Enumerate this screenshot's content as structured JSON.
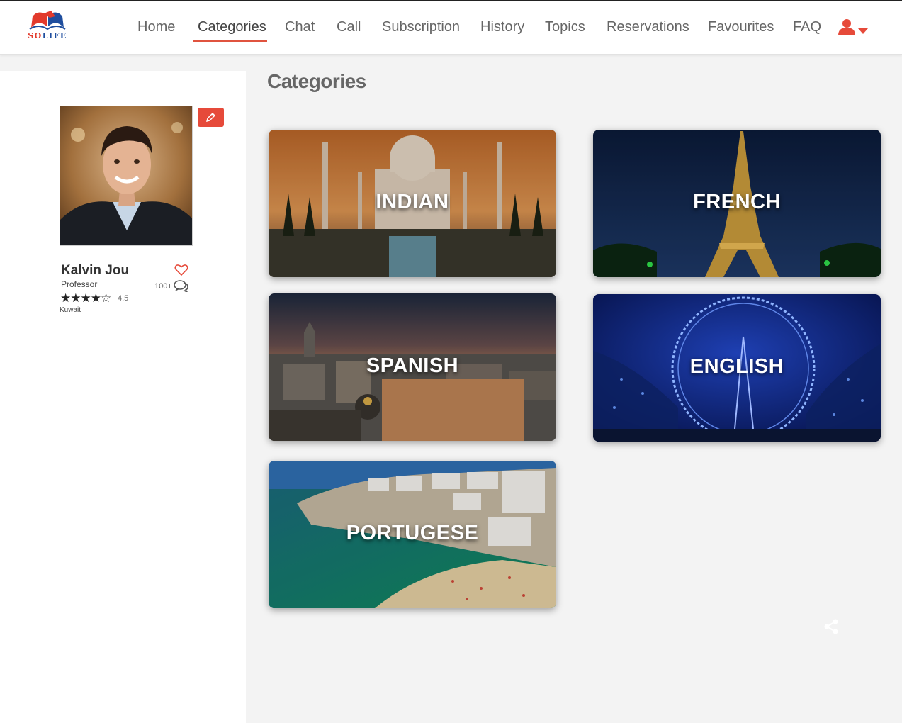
{
  "brand": {
    "logo_text_a": "SO",
    "logo_text_b": "LIFE",
    "accent": "#e64a3a",
    "blue": "#1f4e9e"
  },
  "nav": {
    "items": [
      {
        "label": "Home"
      },
      {
        "label": "Categories",
        "active": true
      },
      {
        "label": "Chat"
      },
      {
        "label": "Call"
      },
      {
        "label": "Subscription"
      },
      {
        "label": "History"
      },
      {
        "label": "Topics"
      },
      {
        "label": "Reservations"
      },
      {
        "label": "Favourites"
      },
      {
        "label": "FAQ"
      }
    ],
    "user_icon": "user-icon",
    "dropdown_icon": "caret-down-icon"
  },
  "profile": {
    "name": "Kalvin Jou",
    "role": "Professor",
    "stars": "★★★★☆",
    "rating": "4.5",
    "location": "Kuwait",
    "reviews": "100+",
    "favorite_icon": "heart-outline-icon",
    "reviews_icon": "chat-bubbles-icon",
    "edit_icon": "pencil-icon"
  },
  "main": {
    "title": "Categories",
    "categories": [
      {
        "label": "INDIAN"
      },
      {
        "label": "FRENCH"
      },
      {
        "label": "SPANISH"
      },
      {
        "label": "ENGLISH"
      },
      {
        "label": "PORTUGESE"
      }
    ],
    "share_icon": "share-icon"
  }
}
